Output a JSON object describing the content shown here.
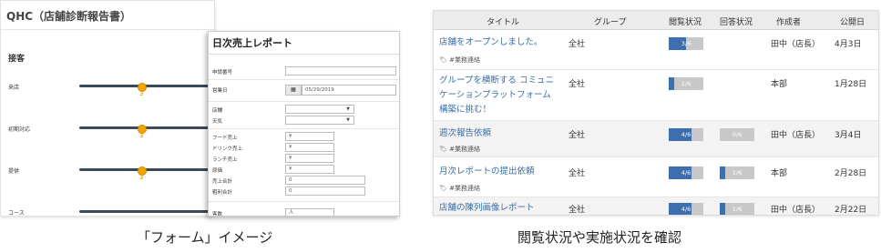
{
  "qhc": {
    "title": "QHC（店舗診断報告書）",
    "section": "接客",
    "sliders": [
      {
        "label": "来店",
        "value": "3",
        "level": 0.5
      },
      {
        "label": "初期対応",
        "value": "3",
        "level": 0.5
      },
      {
        "label": "提供",
        "value": "3",
        "level": 0.5
      },
      {
        "label": "コース",
        "value": "",
        "level": 0.5
      }
    ]
  },
  "daily": {
    "title": "日次売上レポート",
    "fields": {
      "apply_no": "申請番号",
      "business_day": "営業日",
      "business_day_value": "05/29/2019",
      "store": "店舗",
      "weather": "天気",
      "food_sales": "フード売上",
      "drink_sales": "ドリンク売上",
      "lunch_sales": "ランチ売上",
      "cost": "原価",
      "yen": "¥",
      "sales_total": "売上合計",
      "profit_total": "粗利合計",
      "zero": "0",
      "customers": "客数",
      "person": "人"
    }
  },
  "table": {
    "headers": [
      "タイトル",
      "グループ",
      "閲覧状況",
      "回答状況",
      "作成者",
      "公開日"
    ],
    "rows": [
      {
        "title": "店舗をオープンしました。",
        "tag": "#業務連絡",
        "group": "全社",
        "view": "3/6",
        "view_frac": 0.5,
        "answer": "",
        "answer_frac": null,
        "author": "田中（店長）",
        "date": "4月3日"
      },
      {
        "title": "グループを横断する コミュニケーションプラットフォーム構築に挑む！",
        "tag": "",
        "group": "全社",
        "view": "1/6",
        "view_frac": 0.17,
        "answer": "",
        "answer_frac": null,
        "author": "本部",
        "date": "1月28日"
      },
      {
        "title": "週次報告依頼",
        "tag": "#業務連絡",
        "group": "全社",
        "view": "4/6",
        "view_frac": 0.67,
        "answer": "0/6",
        "answer_frac": 0,
        "author": "田中（店長）",
        "date": "3月4日"
      },
      {
        "title": "月次レポートの提出依頼",
        "tag": "#業務連絡",
        "group": "全社",
        "view": "4/6",
        "view_frac": 0.67,
        "answer": "1/6",
        "answer_frac": 0.17,
        "author": "本部",
        "date": "2月28日"
      },
      {
        "title": "店舗の陳列画像レポート",
        "tag": "",
        "group": "全社",
        "view": "4/6",
        "view_frac": 0.67,
        "answer": "1/6",
        "answer_frac": 0.17,
        "author": "田中（店長）",
        "date": "2月22日"
      }
    ]
  },
  "captions": {
    "left": "「フォーム」イメージ",
    "right": "閲覧状況や実施状況を確認"
  },
  "colors": {
    "accent": "#3c6fb0",
    "slider": "#f2a400",
    "link": "#3a6ea5"
  },
  "icons": {
    "calendar": "calendar-icon",
    "tag": "tag-icon"
  }
}
